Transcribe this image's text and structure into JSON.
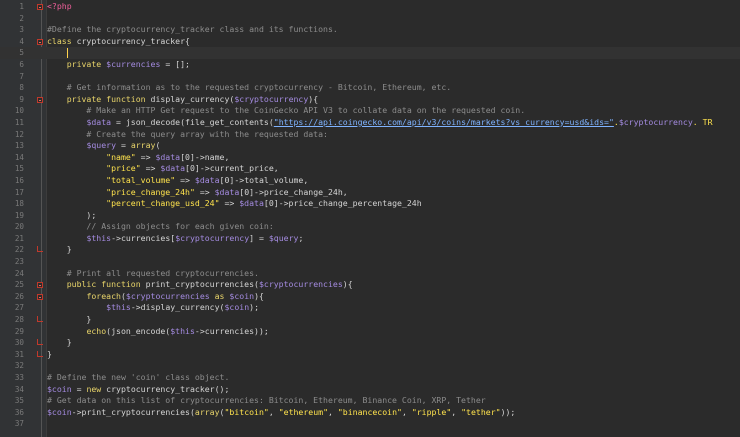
{
  "editor": {
    "language": "php",
    "current_line": 5,
    "lines": [
      {
        "n": "1",
        "fold": "open",
        "tokens": [
          [
            "php",
            "<?php"
          ]
        ]
      },
      {
        "n": "2",
        "tokens": []
      },
      {
        "n": "3",
        "tokens": [
          [
            "c",
            "#Define the cryptocurrency_tracker class and its functions."
          ]
        ]
      },
      {
        "n": "4",
        "fold": "open",
        "tokens": [
          [
            "k",
            "class "
          ],
          [
            "p",
            "cryptocurrency_tracker{"
          ]
        ]
      },
      {
        "n": "5",
        "tokens": [],
        "caret": true
      },
      {
        "n": "6",
        "tokens": [
          [
            "p",
            "    "
          ],
          [
            "k",
            "private "
          ],
          [
            "v",
            "$currencies"
          ],
          [
            "p",
            " = [];"
          ]
        ]
      },
      {
        "n": "7",
        "tokens": []
      },
      {
        "n": "8",
        "tokens": [
          [
            "c",
            "    # Get information as to the requested cryptocurrency - Bitcoin, Ethereum, etc."
          ]
        ]
      },
      {
        "n": "9",
        "fold": "open",
        "tokens": [
          [
            "p",
            "    "
          ],
          [
            "k",
            "private function "
          ],
          [
            "p",
            "display_currency("
          ],
          [
            "v",
            "$cryptocurrency"
          ],
          [
            "p",
            "){"
          ]
        ]
      },
      {
        "n": "10",
        "tokens": [
          [
            "c",
            "        # Make an HTTP Get request to the CoinGecko API V3 to collate data on the requested coin."
          ]
        ]
      },
      {
        "n": "11",
        "tokens": [
          [
            "p",
            "        "
          ],
          [
            "v",
            "$data"
          ],
          [
            "p",
            " = json_decode(file_get_contents("
          ],
          [
            "u",
            "\"https://api.coingecko.com/api/v3/coins/markets?vs_currency=usd&ids=\""
          ],
          [
            "s",
            "."
          ],
          [
            "v",
            "$cryptocurrency"
          ],
          [
            "s",
            ". TR"
          ]
        ]
      },
      {
        "n": "12",
        "tokens": [
          [
            "c",
            "        # Create the query array with the requested data:"
          ]
        ]
      },
      {
        "n": "13",
        "tokens": [
          [
            "p",
            "        "
          ],
          [
            "v",
            "$query"
          ],
          [
            "p",
            " = "
          ],
          [
            "k",
            "array"
          ],
          [
            "p",
            "("
          ]
        ]
      },
      {
        "n": "14",
        "tokens": [
          [
            "p",
            "            "
          ],
          [
            "s",
            "\"name\""
          ],
          [
            "p",
            " => "
          ],
          [
            "v",
            "$data"
          ],
          [
            "p",
            "[0]->name,"
          ]
        ]
      },
      {
        "n": "15",
        "tokens": [
          [
            "p",
            "            "
          ],
          [
            "s",
            "\"price\""
          ],
          [
            "p",
            " => "
          ],
          [
            "v",
            "$data"
          ],
          [
            "p",
            "[0]->current_price,"
          ]
        ]
      },
      {
        "n": "16",
        "tokens": [
          [
            "p",
            "            "
          ],
          [
            "s",
            "\"total_volume\""
          ],
          [
            "p",
            " => "
          ],
          [
            "v",
            "$data"
          ],
          [
            "p",
            "[0]->total_volume,"
          ]
        ]
      },
      {
        "n": "17",
        "tokens": [
          [
            "p",
            "            "
          ],
          [
            "s",
            "\"price_change_24h\""
          ],
          [
            "p",
            " => "
          ],
          [
            "v",
            "$data"
          ],
          [
            "p",
            "[0]->price_change_24h,"
          ]
        ]
      },
      {
        "n": "18",
        "tokens": [
          [
            "p",
            "            "
          ],
          [
            "s",
            "\"percent_change_usd_24\""
          ],
          [
            "p",
            " => "
          ],
          [
            "v",
            "$data"
          ],
          [
            "p",
            "[0]->price_change_percentage_24h"
          ]
        ]
      },
      {
        "n": "19",
        "tokens": [
          [
            "p",
            "        );"
          ]
        ]
      },
      {
        "n": "20",
        "tokens": [
          [
            "c",
            "        // Assign objects for each given coin:"
          ]
        ]
      },
      {
        "n": "21",
        "tokens": [
          [
            "p",
            "        "
          ],
          [
            "v",
            "$this"
          ],
          [
            "p",
            "->currencies["
          ],
          [
            "v",
            "$cryptocurrency"
          ],
          [
            "p",
            "] = "
          ],
          [
            "v",
            "$query"
          ],
          [
            "p",
            ";"
          ]
        ]
      },
      {
        "n": "22",
        "fold": "end",
        "tokens": [
          [
            "p",
            "    }"
          ]
        ]
      },
      {
        "n": "23",
        "tokens": []
      },
      {
        "n": "24",
        "tokens": [
          [
            "c",
            "    # Print all requested cryptocurrencies."
          ]
        ]
      },
      {
        "n": "25",
        "fold": "open",
        "tokens": [
          [
            "p",
            "    "
          ],
          [
            "k",
            "public function "
          ],
          [
            "p",
            "print_cryptocurrencies("
          ],
          [
            "v",
            "$cryptocurrencies"
          ],
          [
            "p",
            "){"
          ]
        ]
      },
      {
        "n": "26",
        "fold": "open",
        "tokens": [
          [
            "p",
            "        "
          ],
          [
            "k",
            "foreach"
          ],
          [
            "p",
            "("
          ],
          [
            "v",
            "$cryptocurrencies"
          ],
          [
            "k",
            " as "
          ],
          [
            "v",
            "$coin"
          ],
          [
            "p",
            "){"
          ]
        ]
      },
      {
        "n": "27",
        "tokens": [
          [
            "p",
            "            "
          ],
          [
            "v",
            "$this"
          ],
          [
            "p",
            "->display_currency("
          ],
          [
            "v",
            "$coin"
          ],
          [
            "p",
            ");"
          ]
        ]
      },
      {
        "n": "28",
        "fold": "end",
        "tokens": [
          [
            "p",
            "        }"
          ]
        ]
      },
      {
        "n": "29",
        "tokens": [
          [
            "p",
            "        "
          ],
          [
            "k",
            "echo"
          ],
          [
            "p",
            "(json_encode("
          ],
          [
            "v",
            "$this"
          ],
          [
            "p",
            "->currencies));"
          ]
        ]
      },
      {
        "n": "30",
        "fold": "end",
        "tokens": [
          [
            "p",
            "    }"
          ]
        ]
      },
      {
        "n": "31",
        "fold": "end",
        "tokens": [
          [
            "p",
            "}"
          ]
        ]
      },
      {
        "n": "32",
        "tokens": []
      },
      {
        "n": "33",
        "tokens": [
          [
            "c",
            "# Define the new 'coin' class object."
          ]
        ]
      },
      {
        "n": "34",
        "tokens": [
          [
            "v",
            "$coin"
          ],
          [
            "p",
            " = "
          ],
          [
            "k",
            "new "
          ],
          [
            "p",
            "cryptocurrency_tracker();"
          ]
        ]
      },
      {
        "n": "35",
        "tokens": [
          [
            "c",
            "# Get data on this list of cryptocurrencies: Bitcoin, Ethereum, Binance Coin, XRP, Tether"
          ]
        ]
      },
      {
        "n": "36",
        "tokens": [
          [
            "v",
            "$coin"
          ],
          [
            "p",
            "->print_cryptocurrencies("
          ],
          [
            "k",
            "array"
          ],
          [
            "p",
            "("
          ],
          [
            "s",
            "\"bitcoin\""
          ],
          [
            "p",
            ", "
          ],
          [
            "s",
            "\"ethereum\""
          ],
          [
            "p",
            ", "
          ],
          [
            "s",
            "\"binancecoin\""
          ],
          [
            "p",
            ", "
          ],
          [
            "s",
            "\"ripple\""
          ],
          [
            "p",
            ", "
          ],
          [
            "s",
            "\"tether\""
          ],
          [
            "p",
            "));"
          ]
        ]
      },
      {
        "n": "37",
        "tokens": []
      }
    ]
  }
}
